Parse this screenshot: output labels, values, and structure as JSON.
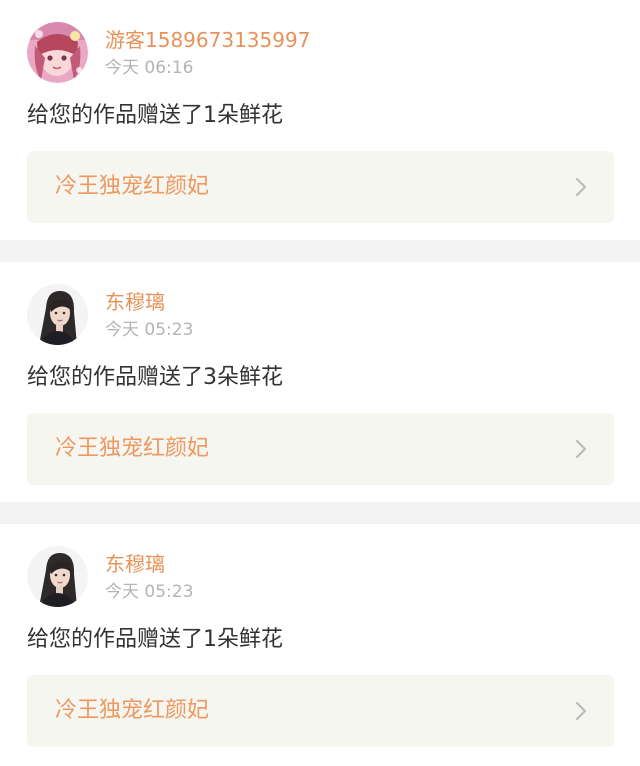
{
  "notifications": [
    {
      "user": "游客1589673135997",
      "time": "今天 06:16",
      "message": "给您的作品赠送了1朵鲜花",
      "work_title": "冷王独宠红颜妃",
      "avatar_icon": "anime-girl-avatar"
    },
    {
      "user": "东穆璃",
      "time": "今天 05:23",
      "message": "给您的作品赠送了3朵鲜花",
      "work_title": "冷王独宠红颜妃",
      "avatar_icon": "woman-portrait-avatar"
    },
    {
      "user": "东穆璃",
      "time": "今天 05:23",
      "message": "给您的作品赠送了1朵鲜花",
      "work_title": "冷王独宠红颜妃",
      "avatar_icon": "woman-portrait-avatar"
    }
  ],
  "colors": {
    "accent": "#e8925a",
    "timestamp": "#b4b4b4",
    "message": "#333333",
    "card_background": "#f6f6f0",
    "separator": "#f3f3f3",
    "chevron": "#bbbbbb"
  },
  "icons": {
    "chevron": "chevron-right-icon"
  }
}
